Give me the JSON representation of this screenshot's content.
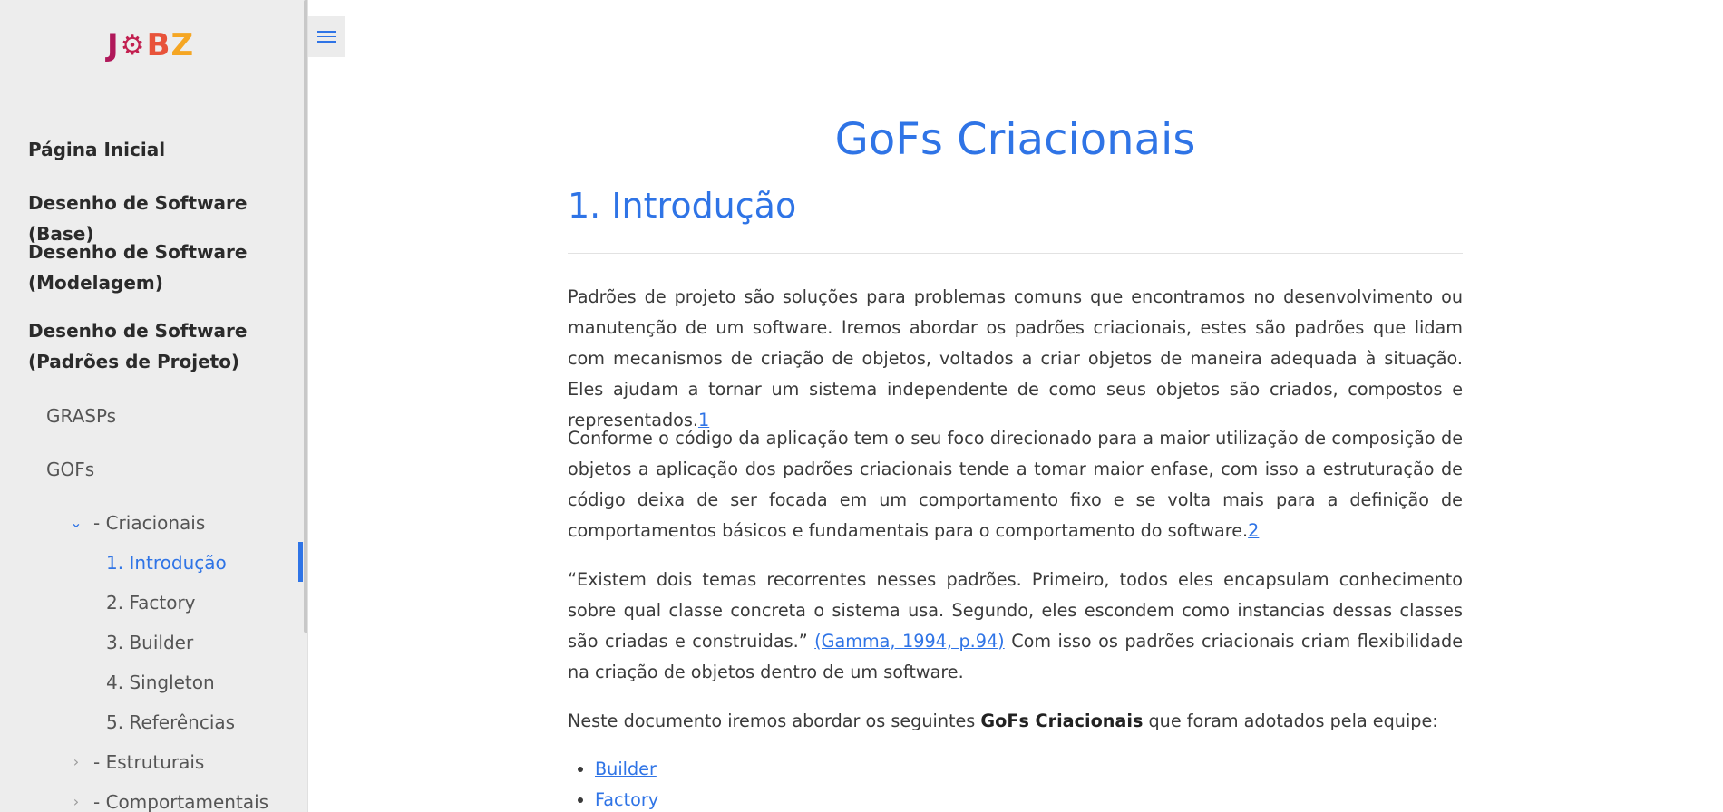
{
  "logo": {
    "part1": "J",
    "gear": "⚙",
    "part2": "B",
    "part3": "Z"
  },
  "sidebar": {
    "top_items": [
      "Página Inicial",
      "Desenho de Software (Base)",
      "Desenho de Software (Modelagem)",
      "Desenho de Software (Padrões de Projeto)"
    ],
    "sub_items": [
      "GRASPs",
      "GOFs"
    ],
    "criacionais": {
      "label": "- Criacionais",
      "expanded": true
    },
    "criacionais_children": [
      {
        "label": "1. Introdução",
        "active": true
      },
      {
        "label": "2. Factory"
      },
      {
        "label": "3. Builder"
      },
      {
        "label": "4. Singleton"
      },
      {
        "label": "5. Referências"
      }
    ],
    "estruturais": "- Estruturais",
    "comportamentais": "- Comportamentais"
  },
  "colors": {
    "accent": "#2f74e6",
    "sidebar_bg": "#ededed",
    "text": "#3a3a3a"
  },
  "page": {
    "title": "GoFs Criacionais",
    "section_title": "1. Introdução",
    "p1_text": "Padrões de projeto são soluções para problemas comuns que encontramos no desenvolvimento ou manutenção de um software. Iremos abordar os padrões criacionais, estes são padrões que lidam com mecanismos de criação de objetos, voltados a criar objetos de maneira adequada à situação. Eles ajudam a tornar um sistema independente de como seus objetos são criados, compostos e representados.",
    "p1_ref": "1",
    "p2_text": "Conforme o código da aplicação tem o seu foco direcionado para a maior utilização de composição de objetos a aplicação dos padrões criacionais tende a tomar maior enfase, com isso a estruturação de código deixa de ser focada em um comportamento fixo e se volta mais para a definição de comportamentos básicos e fundamentais para o comportamento do software.",
    "p2_ref": "2",
    "p3_text": "“Existem dois temas recorrentes nesses padrões. Primeiro, todos eles encapsulam conhecimento sobre qual classe concreta o sistema usa. Segundo, eles escondem como instancias dessas classes são criadas e construidas.”",
    "p3_cite": "(Gamma, 1994, p.94)",
    "p3_rest": "Com isso os padrões criacionais criam flexibilidade na criação de objetos dentro de um software.",
    "p4_pre": "Neste documento iremos abordar os seguintes",
    "p4_bold": "GoFs Criacionais",
    "p4_post": "que foram adotados pela equipe:",
    "list": [
      "Builder",
      "Factory"
    ]
  }
}
